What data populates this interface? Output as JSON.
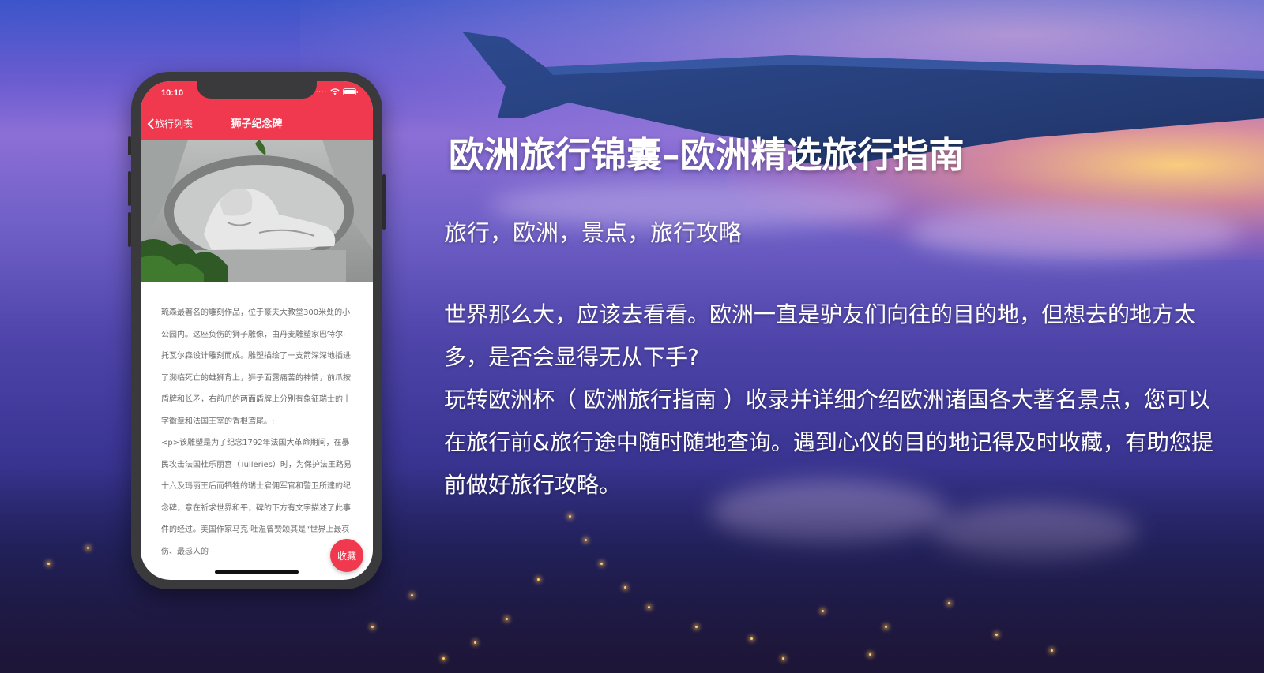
{
  "phone": {
    "status_time": "10:10",
    "nav_back_label": "旅行列表",
    "nav_title": "狮子纪念碑",
    "article_text": "琉森最著名的雕刻作品，位于豪夫大教堂300米处的小公园内。这座负伤的狮子雕像，由丹麦雕塑家巴特尔·托瓦尔森设计雕刻而成。雕塑描绘了一支箭深深地插进了濒临死亡的雄狮背上，狮子面露痛苦的神情，前爪按盾牌和长矛，右前爪的两面盾牌上分别有象征瑞士的十字徽章和法国王室的香根鸢尾。;\n<p>该雕塑是为了纪念1792年法国大革命期间，在暴民攻击法国杜乐丽宫（Tuileries）时，为保护法王路易十六及玛丽王后而牺牲的瑞士雇佣军官和警卫所建的纪念碑，意在祈求世界和平，碑的下方有文字描述了此事件的经过。美国作家马克·吐温曾赞颂其是“世界上最哀伤、最感人的",
    "fav_button_label": "收藏",
    "accent_color": "#f0394f"
  },
  "promo": {
    "title": "欧洲旅行锦囊–欧洲精选旅行指南",
    "tags": "旅行，欧洲，景点，旅行攻略",
    "paragraph_1": "世界那么大，应该去看看。欧洲一直是驴友们向往的目的地，但想去的地方太多，是否会显得无从下手?",
    "paragraph_2": "玩转欧洲杯（ 欧洲旅行指南 ）收录并详细介绍欧洲诸国各大著名景点，您可以在旅行前&旅行途中随时随地查询。遇到心仪的目的地记得及时收藏，有助您提前做好旅行攻略。"
  },
  "icons": [
    "chevron-left-icon",
    "wifi-icon",
    "battery-icon",
    "signal-icon"
  ]
}
